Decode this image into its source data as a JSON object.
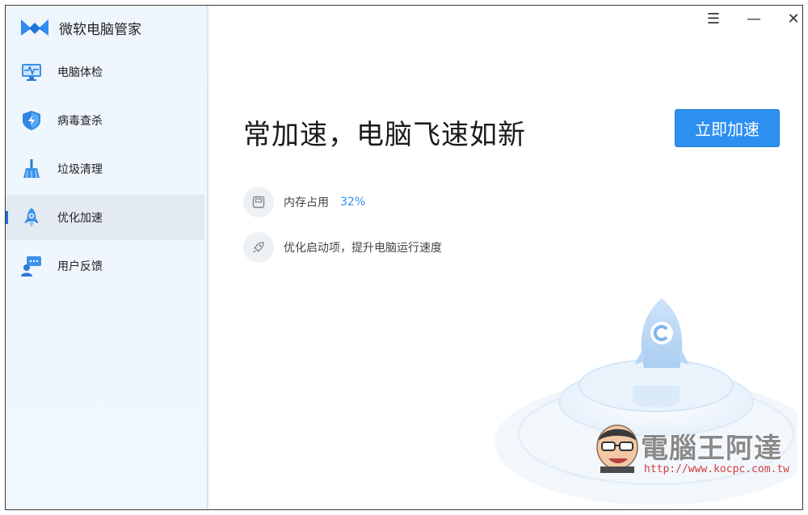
{
  "app": {
    "title": "微软电脑管家"
  },
  "sidebar": {
    "items": [
      {
        "label": "电脑体检",
        "icon": "monitor-icon",
        "active": false
      },
      {
        "label": "病毒查杀",
        "icon": "shield-icon",
        "active": false
      },
      {
        "label": "垃圾清理",
        "icon": "broom-icon",
        "active": false
      },
      {
        "label": "优化加速",
        "icon": "rocket-icon",
        "active": true
      },
      {
        "label": "用户反馈",
        "icon": "feedback-icon",
        "active": false
      }
    ]
  },
  "window_controls": {
    "menu": "☰",
    "minimize": "—",
    "close": "✕"
  },
  "main": {
    "title": "常加速，电脑飞速如新",
    "action_button": "立即加速",
    "memory": {
      "label": "内存占用",
      "value": "32%"
    },
    "startup": {
      "label": "优化启动项，提升电脑运行速度"
    }
  },
  "watermark": {
    "text": "電腦王阿達",
    "url": "http://www.kocpc.com.tw"
  },
  "colors": {
    "accent": "#2d8ff0",
    "sidebar_bg": "#eef5fd",
    "active_bg": "#e3eaf2"
  }
}
